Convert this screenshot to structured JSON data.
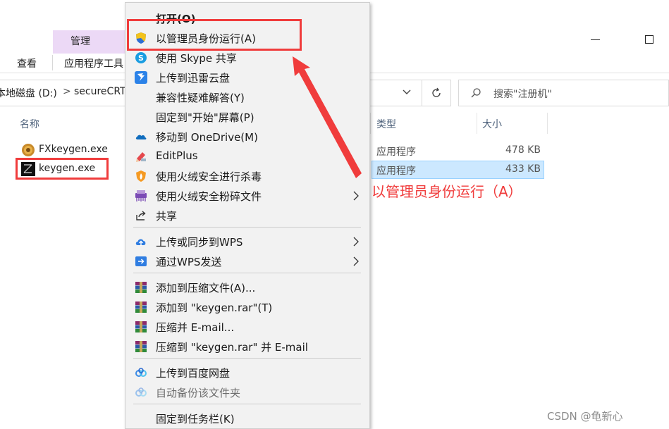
{
  "ribbon": {
    "manage_label": "管理",
    "tab_view": "查看",
    "tab_app_tools": "应用程序工具"
  },
  "address": {
    "path": "本地磁盘 (D:)",
    "chevron": ">",
    "folder": "secureCRT"
  },
  "search": {
    "placeholder": "搜索\"注册机\""
  },
  "columns": {
    "name": "名称",
    "type": "类型",
    "size": "大小"
  },
  "files": [
    {
      "name": "FXkeygen.exe",
      "type": "应用程序",
      "size": "478 KB",
      "selected": false
    },
    {
      "name": "keygen.exe",
      "type": "应用程序",
      "size": "433 KB",
      "selected": true
    }
  ],
  "context_menu": {
    "items": [
      {
        "label": "打开(O)",
        "icon": "none",
        "bold": true
      },
      {
        "label": "以管理员身份运行(A)",
        "icon": "uac-shield-icon"
      },
      {
        "label": "使用 Skype 共享",
        "icon": "skype-icon"
      },
      {
        "label": "上传到迅雷云盘",
        "icon": "thunder-icon"
      },
      {
        "label": "兼容性疑难解答(Y)",
        "icon": "none"
      },
      {
        "label": "固定到\"开始\"屏幕(P)",
        "icon": "none"
      },
      {
        "label": "移动到 OneDrive(M)",
        "icon": "onedrive-icon"
      },
      {
        "label": "EditPlus",
        "icon": "editplus-icon"
      },
      {
        "label": "使用火绒安全进行杀毒",
        "icon": "huorong-icon"
      },
      {
        "label": "使用火绒安全粉碎文件",
        "icon": "shredder-icon",
        "submenu": true
      },
      {
        "label": "共享",
        "icon": "share-icon"
      },
      {
        "label": "上传或同步到WPS",
        "icon": "wps-upload-icon",
        "submenu": true
      },
      {
        "label": "通过WPS发送",
        "icon": "wps-send-icon",
        "submenu": true
      },
      {
        "label": "添加到压缩文件(A)...",
        "icon": "winrar-icon"
      },
      {
        "label": "添加到 \"keygen.rar\"(T)",
        "icon": "winrar-icon"
      },
      {
        "label": "压缩并 E-mail...",
        "icon": "winrar-icon"
      },
      {
        "label": "压缩到 \"keygen.rar\" 并 E-mail",
        "icon": "winrar-icon"
      },
      {
        "label": "上传到百度网盘",
        "icon": "baidu-netdisk-icon"
      },
      {
        "label": "自动备份该文件夹",
        "icon": "baidu-netdisk-icon",
        "disabled": true
      },
      {
        "label": "固定到任务栏(K)",
        "icon": "none"
      }
    ]
  },
  "annotation": {
    "text": "以管理员身份运行（A）",
    "color": "#f03c3c"
  },
  "watermark": "CSDN @龟新心",
  "colors": {
    "manage_tab": "#ecd9f6",
    "selection": "#cce8ff",
    "highlight_red": "#f03c3c",
    "menu_bg": "#f2f2f2"
  }
}
